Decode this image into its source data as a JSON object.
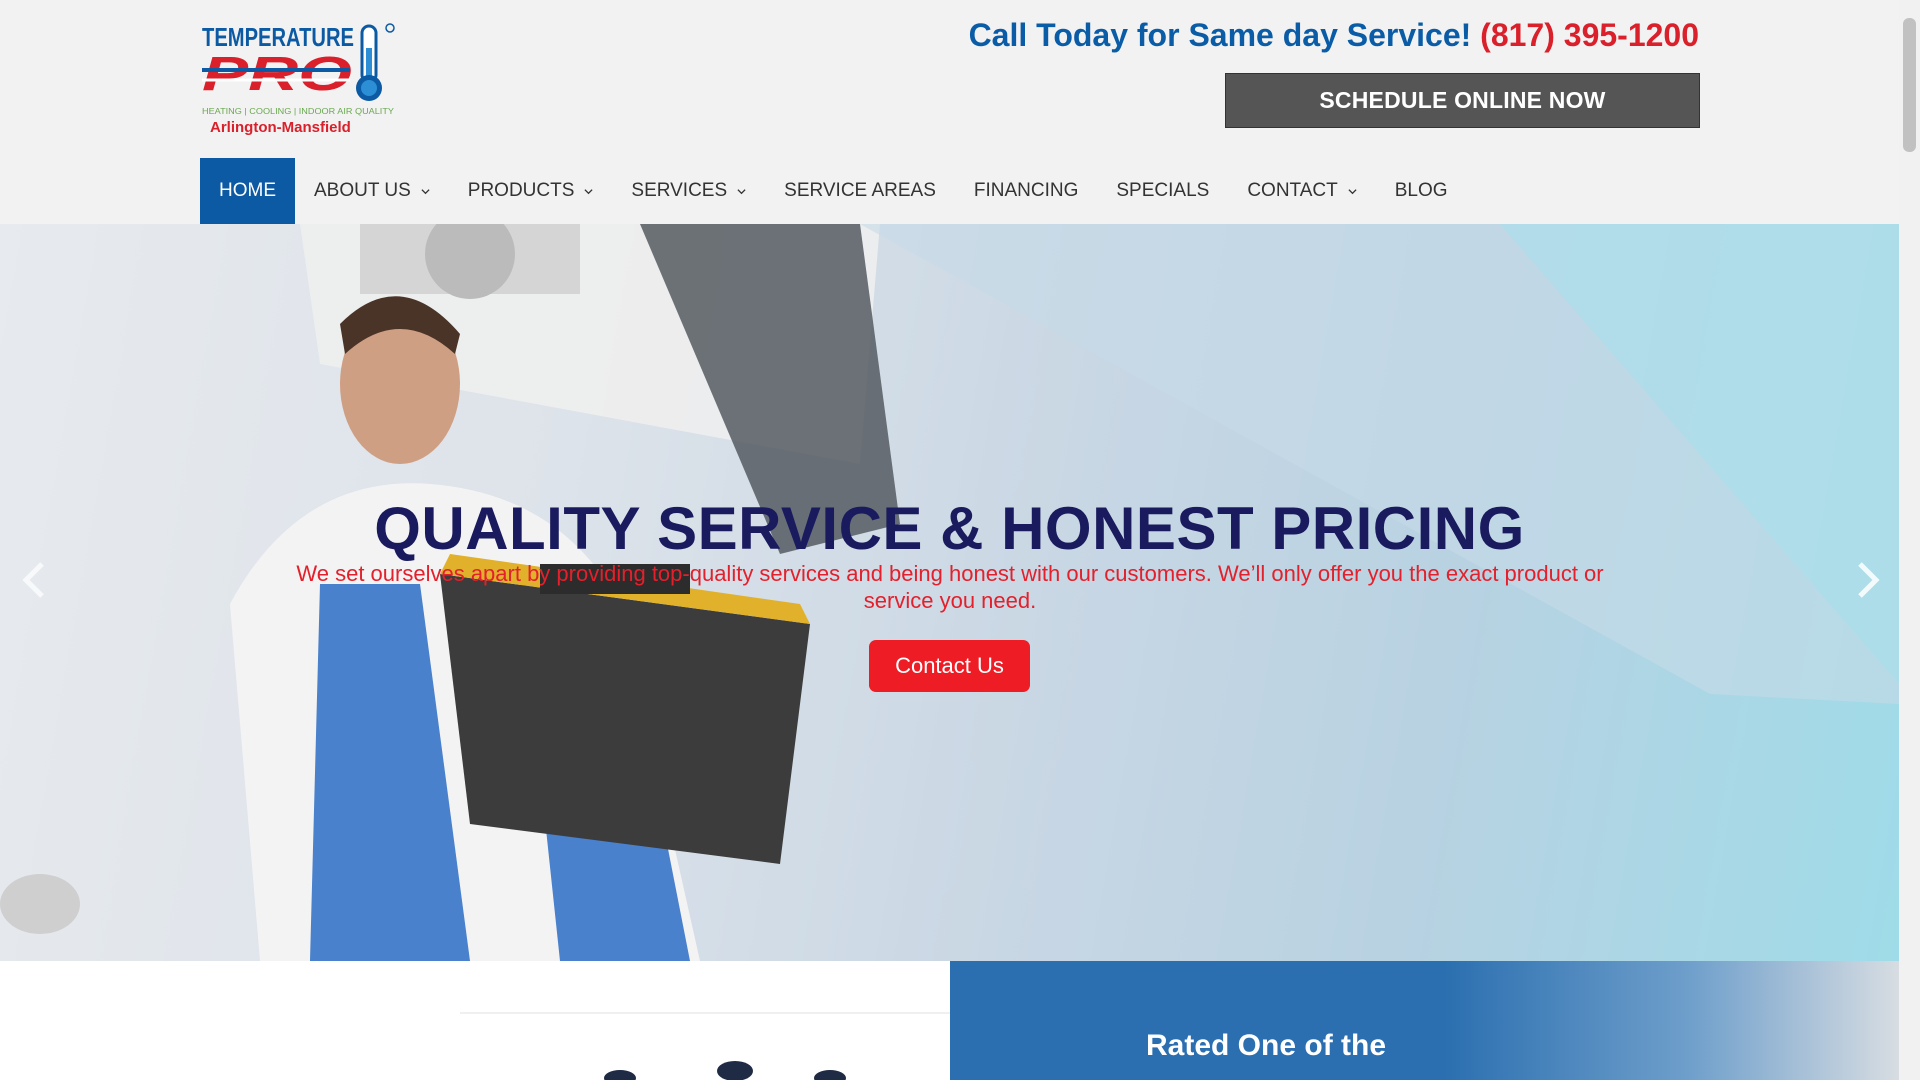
{
  "header": {
    "logo": {
      "brand_top": "TEMPERATURE",
      "brand_main": "PRO",
      "tagline": "HEATING | COOLING | INDOOR AIR QUALITY",
      "location": "Arlington-Mansfield"
    },
    "call_text": "Call Today for Same day Service!",
    "phone": "(817) 395-1200",
    "schedule_label": "SCHEDULE ONLINE NOW"
  },
  "nav": {
    "items": [
      {
        "label": "HOME",
        "active": true,
        "dropdown": false
      },
      {
        "label": "ABOUT US",
        "active": false,
        "dropdown": true
      },
      {
        "label": "PRODUCTS",
        "active": false,
        "dropdown": true
      },
      {
        "label": "SERVICES",
        "active": false,
        "dropdown": true
      },
      {
        "label": "SERVICE AREAS",
        "active": false,
        "dropdown": false
      },
      {
        "label": "FINANCING",
        "active": false,
        "dropdown": false
      },
      {
        "label": "SPECIALS",
        "active": false,
        "dropdown": false
      },
      {
        "label": "CONTACT",
        "active": false,
        "dropdown": true
      },
      {
        "label": "BLOG",
        "active": false,
        "dropdown": false
      }
    ]
  },
  "hero": {
    "title": "QUALITY SERVICE & HONEST PRICING",
    "subtitle": "We set ourselves apart by providing top-quality services and being honest with our customers. We’ll only offer you the exact product or service you need.",
    "cta_label": "Contact Us",
    "prev_icon": "chevron-left-icon",
    "next_icon": "chevron-right-icon"
  },
  "rated": {
    "heading": "Rated One of the"
  },
  "colors": {
    "brand_blue": "#0b5aa3",
    "brand_red": "#ee1c25",
    "title_navy": "#1a1a5e",
    "schedule_gray": "#555555"
  }
}
